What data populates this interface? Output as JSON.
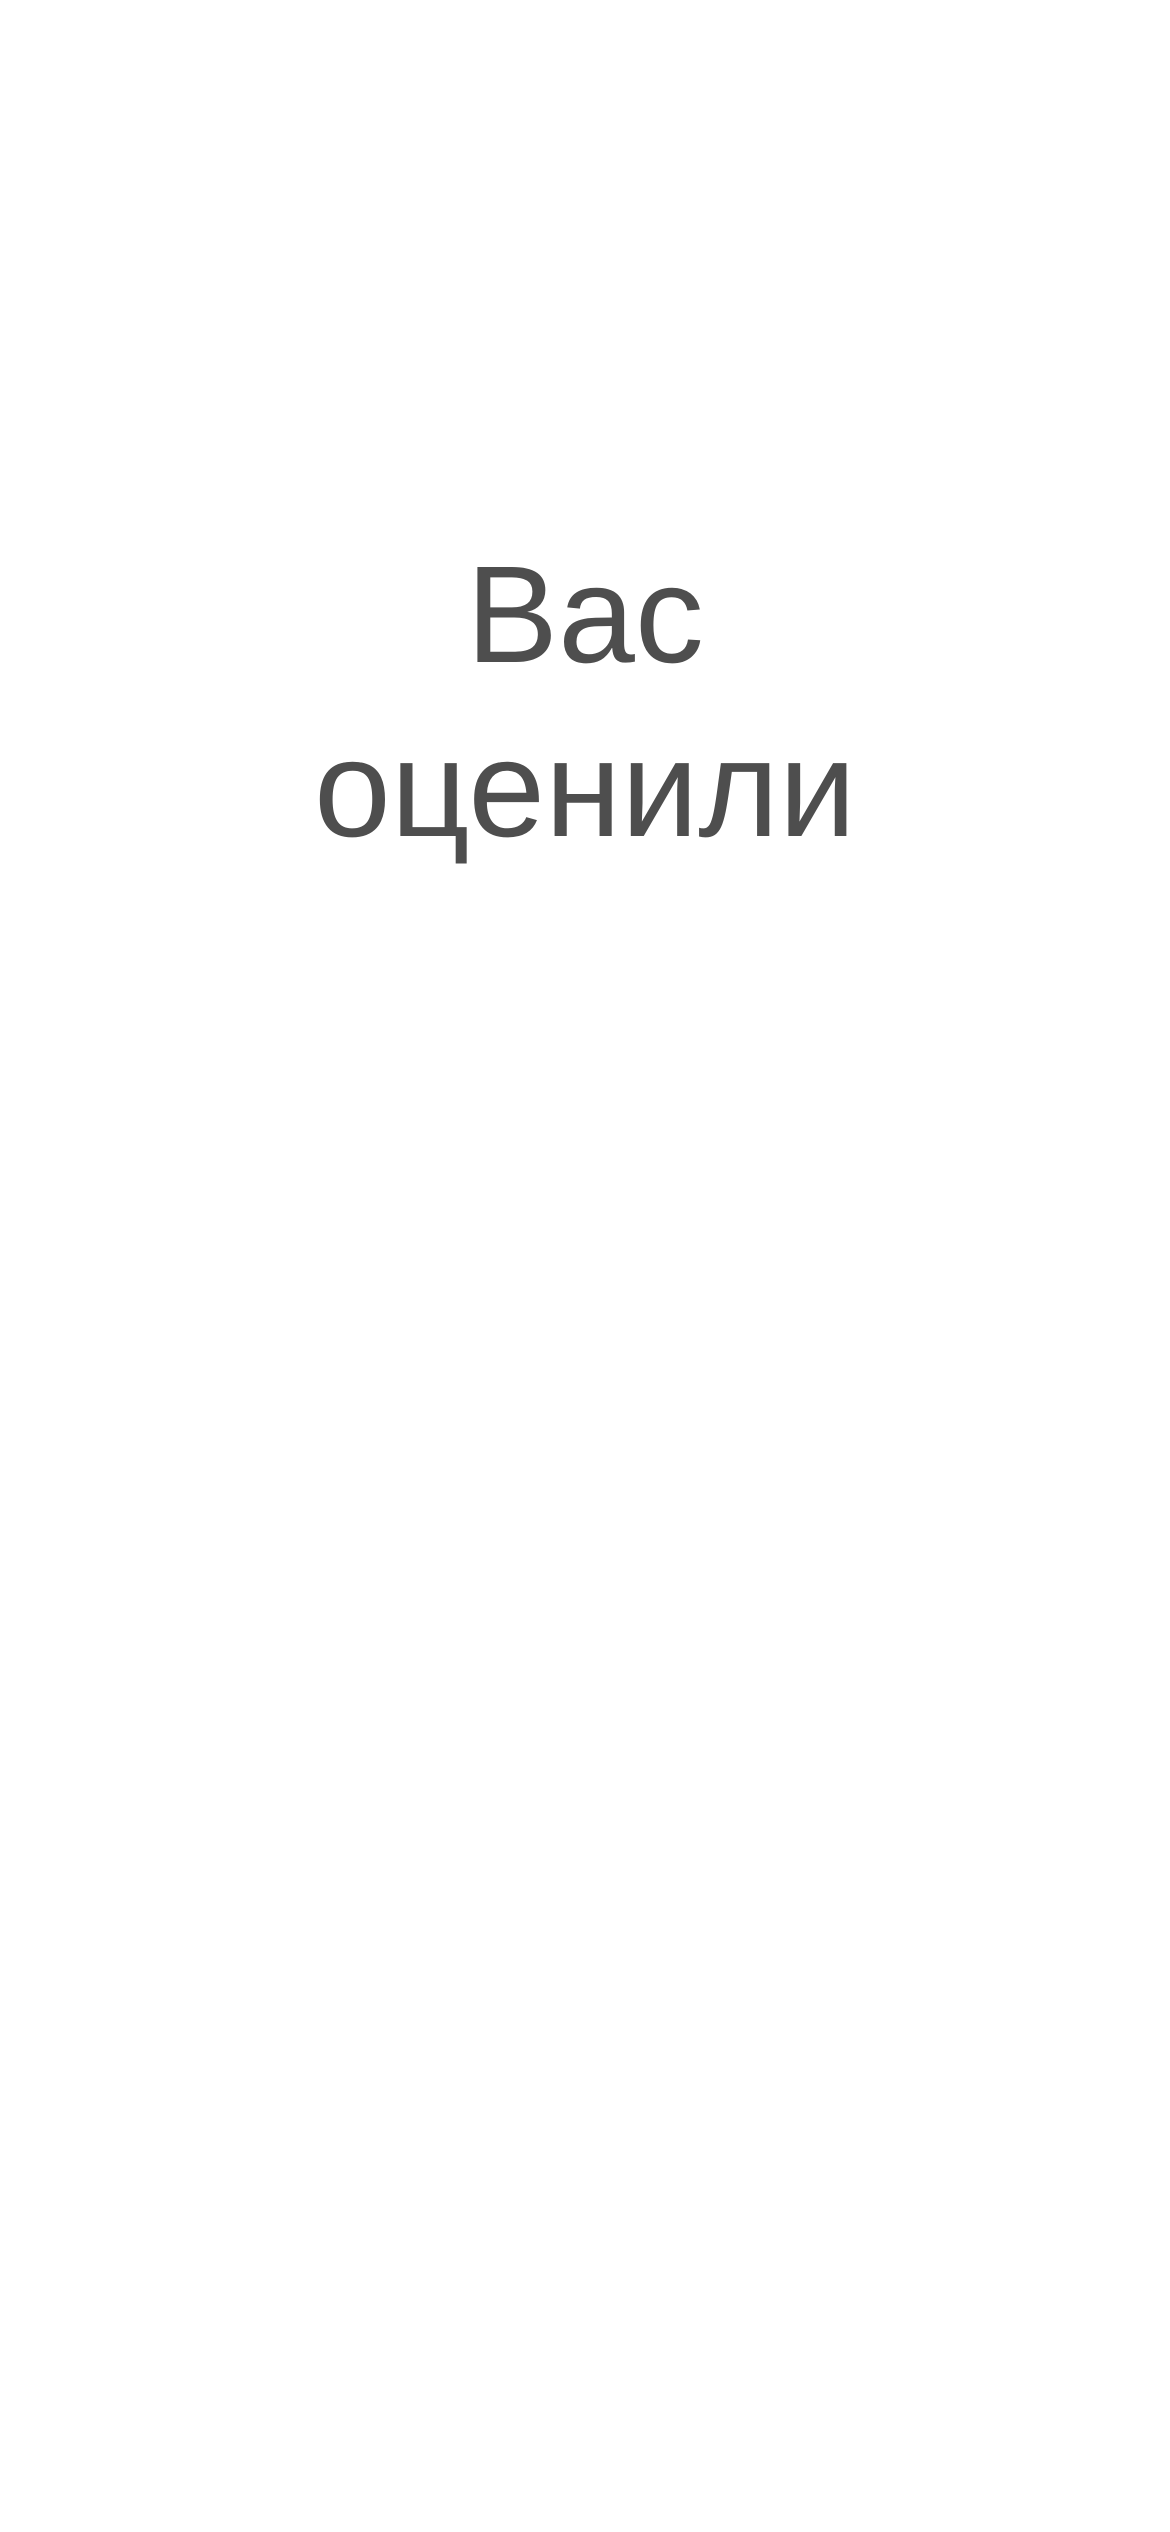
{
  "screen": {
    "title_line1": "Вас",
    "title_line2": "оценили",
    "text_color": "#4e4e4e",
    "background_color": "#ffffff"
  }
}
